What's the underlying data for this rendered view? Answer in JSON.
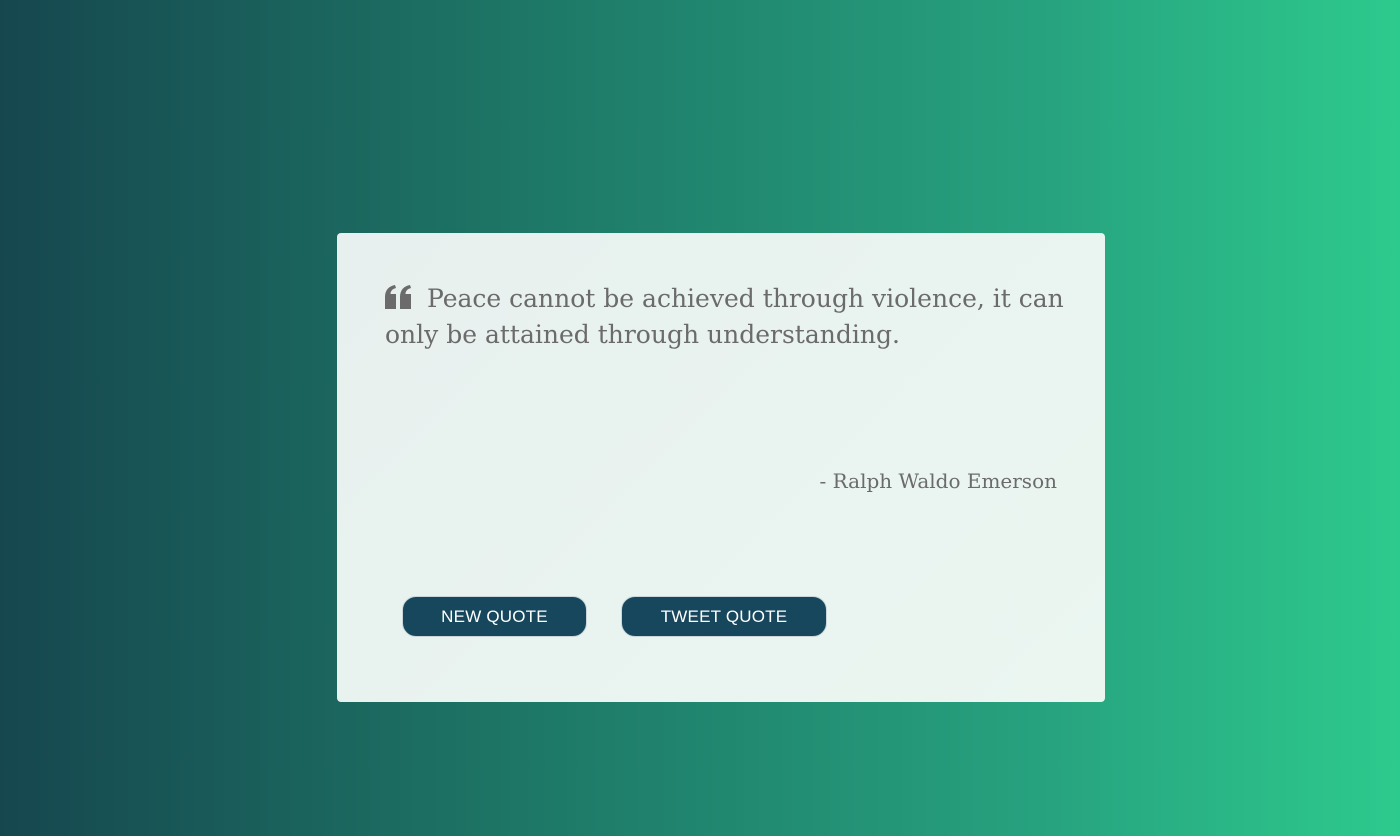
{
  "quote": {
    "text": "Peace cannot be achieved through violence, it can only be attained through understanding.",
    "author": "- Ralph Waldo Emerson",
    "icon": "quote-left-icon"
  },
  "actions": {
    "new_quote_label": "NEW QUOTE",
    "tweet_quote_label": "TWEET QUOTE"
  },
  "colors": {
    "background_start": "#16474f",
    "background_end": "#2dca8d",
    "card": "#e9f3f0",
    "text": "#6b6b6b",
    "button": "#16475c"
  }
}
